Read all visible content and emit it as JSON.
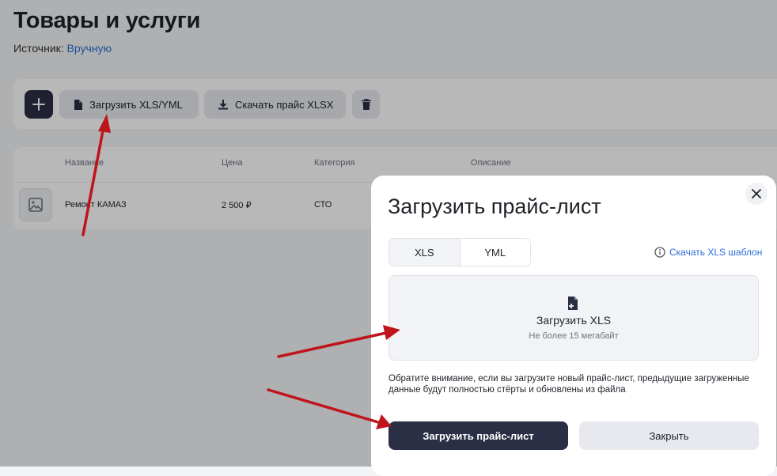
{
  "page": {
    "title": "Товары и услуги",
    "source_label": "Источник:",
    "source_value": "Вручную"
  },
  "toolbar": {
    "add_icon": "plus-icon",
    "upload_label": "Загрузить XLS/YML",
    "download_label": "Скачать прайс XLSX",
    "delete_icon": "trash-icon"
  },
  "table": {
    "columns": [
      "Название",
      "Цена",
      "Категория",
      "Описание"
    ],
    "rows": [
      {
        "name": "Ремонт КАМАЗ",
        "price": "2 500 ₽",
        "category": "СТО",
        "description": ""
      }
    ]
  },
  "modal": {
    "title": "Загрузить прайс-лист",
    "tabs": [
      "XLS",
      "YML"
    ],
    "active_tab": "XLS",
    "template_link": "Скачать XLS шаблон",
    "drop_title": "Загрузить XLS",
    "drop_subtitle": "Не более 15 мегабайт",
    "note": "Обратите внимание, если вы загрузите новый прайс-лист, предыдущие загруженные данные будут полностью стёрты и обновлены из файла",
    "primary_button": "Загрузить прайс-лист",
    "secondary_button": "Закрыть"
  },
  "colors": {
    "accent_dark": "#2b2f45",
    "link": "#2b6fd6",
    "arrow": "#c0141c"
  }
}
